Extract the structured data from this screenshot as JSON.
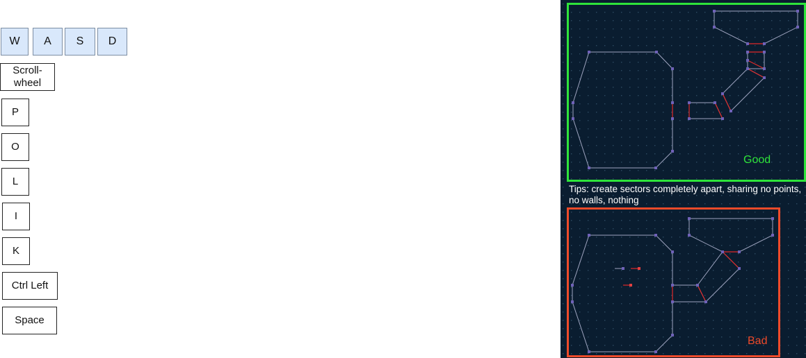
{
  "keys": {
    "w": "W",
    "a": "A",
    "s": "S",
    "d": "D",
    "scroll_line1": "Scroll-",
    "scroll_line2": "wheel",
    "p": "P",
    "o": "O",
    "l": "L",
    "i": "I",
    "k": "K",
    "ctrl_left": "Ctrl Left",
    "space": "Space"
  },
  "panel": {
    "good_label": "Good",
    "bad_label": "Bad",
    "tip": "Tips: create sectors completely apart, sharing no points, no walls, nothing",
    "colors": {
      "background": "#0a1d30",
      "good_frame": "#2ee43a",
      "bad_frame": "#ee4a2a",
      "wall": "#9ea4bf",
      "portal": "#e02a2a",
      "vertex": "#6f62b8",
      "grid_dot": "#2e4a63"
    }
  }
}
